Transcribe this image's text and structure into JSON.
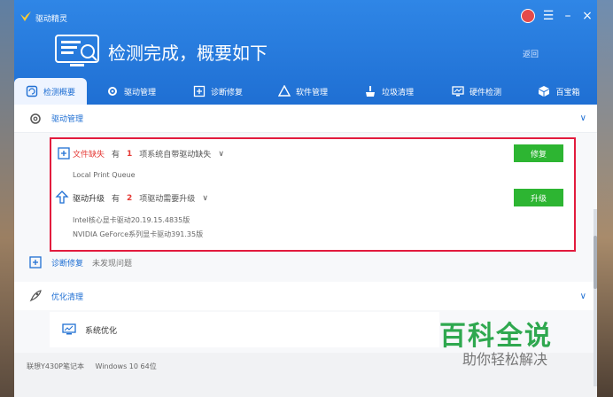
{
  "app": {
    "title": "驱动精灵"
  },
  "header": {
    "headline": "检测完成，概要如下",
    "back_label": "返回"
  },
  "tabs": [
    {
      "label": "检测概要",
      "icon": "refresh-icon"
    },
    {
      "label": "驱动管理",
      "icon": "gear-icon"
    },
    {
      "label": "诊断修复",
      "icon": "repair-icon"
    },
    {
      "label": "软件管理",
      "icon": "triangle-icon"
    },
    {
      "label": "垃圾清理",
      "icon": "broom-icon"
    },
    {
      "label": "硬件检测",
      "icon": "monitor-icon"
    },
    {
      "label": "百宝箱",
      "icon": "box-icon"
    }
  ],
  "sections": {
    "driver_mgmt": {
      "label": "驱动管理"
    },
    "diagnose": {
      "label": "诊断修复",
      "status": "未发现问题"
    },
    "optimize": {
      "label": "优化清理"
    },
    "sys_opt": {
      "label": "系统优化"
    }
  },
  "issues": {
    "missing": {
      "title": "文件缺失",
      "prefix": "有",
      "count": "1",
      "desc": "项系统自带驱动缺失",
      "item": "Local Print Queue",
      "button": "修复"
    },
    "upgrade": {
      "title": "驱动升级",
      "prefix": "有",
      "count": "2",
      "desc": "项驱动需要升级",
      "items": [
        "Intel核心显卡驱动20.19.15.4835版",
        "NVIDIA GeForce系列显卡驱动391.35版"
      ],
      "button": "升级"
    }
  },
  "footer": {
    "device": "联想Y430P笔记本",
    "os": "Windows 10 64位"
  },
  "watermark": {
    "title": "百科全说",
    "subtitle": "助你轻松解决"
  },
  "colors": {
    "primary": "#1f6fd3",
    "danger": "#e53935",
    "success": "#2db532",
    "highlight": "#e21b3d"
  }
}
